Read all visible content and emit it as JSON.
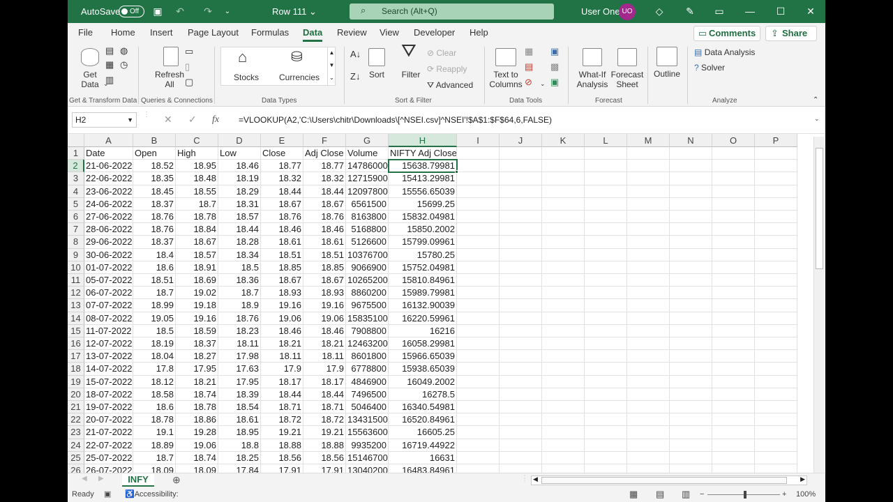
{
  "titlebar": {
    "autosave": "AutoSave",
    "toggle": "Off",
    "doc": "Row 111",
    "search": "Search (Alt+Q)",
    "user": "User One",
    "initials": "UO"
  },
  "menu": [
    "File",
    "Home",
    "Insert",
    "Page Layout",
    "Formulas",
    "Data",
    "Review",
    "View",
    "Developer",
    "Help"
  ],
  "top_buttons": {
    "comments": "Comments",
    "share": "Share"
  },
  "ribbon": {
    "get_data": "Get Data",
    "refresh_all": "Refresh All",
    "stocks": "Stocks",
    "currencies": "Currencies",
    "sort": "Sort",
    "filter": "Filter",
    "clear": "Clear",
    "reapply": "Reapply",
    "advanced": "Advanced",
    "text_to_columns": "Text to Columns",
    "what_if": "What-If Analysis",
    "forecast_sheet": "Forecast Sheet",
    "outline": "Outline",
    "data_analysis": "Data Analysis",
    "solver": "Solver",
    "groups": [
      "Get & Transform Data",
      "Queries & Connections",
      "Data Types",
      "Sort & Filter",
      "Data Tools",
      "Forecast",
      "Analyze"
    ]
  },
  "formula_bar": {
    "name_box": "H2",
    "fx": "fx",
    "formula": "=VLOOKUP(A2,'C:\\Users\\chitr\\Downloads\\[^NSEI.csv]^NSEI'!$A$1:$F$64,6,FALSE)"
  },
  "columns": [
    "A",
    "B",
    "C",
    "D",
    "E",
    "F",
    "G",
    "H",
    "I",
    "J",
    "K",
    "L",
    "M",
    "N",
    "O",
    "P"
  ],
  "header_row": [
    "Date",
    "Open",
    "High",
    "Low",
    "Close",
    "Adj Close",
    "Volume",
    "NIFTY Adj Close"
  ],
  "rows": [
    [
      "21-06-2022",
      "18.52",
      "18.95",
      "18.46",
      "18.77",
      "18.77",
      "14786000",
      "15638.79981"
    ],
    [
      "22-06-2022",
      "18.35",
      "18.48",
      "18.19",
      "18.32",
      "18.32",
      "12715900",
      "15413.29981"
    ],
    [
      "23-06-2022",
      "18.45",
      "18.55",
      "18.29",
      "18.44",
      "18.44",
      "12097800",
      "15556.65039"
    ],
    [
      "24-06-2022",
      "18.37",
      "18.7",
      "18.31",
      "18.67",
      "18.67",
      "6561500",
      "15699.25"
    ],
    [
      "27-06-2022",
      "18.76",
      "18.78",
      "18.57",
      "18.76",
      "18.76",
      "8163800",
      "15832.04981"
    ],
    [
      "28-06-2022",
      "18.76",
      "18.84",
      "18.44",
      "18.46",
      "18.46",
      "5168800",
      "15850.2002"
    ],
    [
      "29-06-2022",
      "18.37",
      "18.67",
      "18.28",
      "18.61",
      "18.61",
      "5126600",
      "15799.09961"
    ],
    [
      "30-06-2022",
      "18.4",
      "18.57",
      "18.34",
      "18.51",
      "18.51",
      "10376700",
      "15780.25"
    ],
    [
      "01-07-2022",
      "18.6",
      "18.91",
      "18.5",
      "18.85",
      "18.85",
      "9066900",
      "15752.04981"
    ],
    [
      "05-07-2022",
      "18.51",
      "18.69",
      "18.36",
      "18.67",
      "18.67",
      "10265200",
      "15810.84961"
    ],
    [
      "06-07-2022",
      "18.7",
      "19.02",
      "18.7",
      "18.93",
      "18.93",
      "8860200",
      "15989.79981"
    ],
    [
      "07-07-2022",
      "18.99",
      "19.18",
      "18.9",
      "19.16",
      "19.16",
      "9675500",
      "16132.90039"
    ],
    [
      "08-07-2022",
      "19.05",
      "19.16",
      "18.76",
      "19.06",
      "19.06",
      "15835100",
      "16220.59961"
    ],
    [
      "11-07-2022",
      "18.5",
      "18.59",
      "18.23",
      "18.46",
      "18.46",
      "7908800",
      "16216"
    ],
    [
      "12-07-2022",
      "18.19",
      "18.37",
      "18.11",
      "18.21",
      "18.21",
      "12463200",
      "16058.29981"
    ],
    [
      "13-07-2022",
      "18.04",
      "18.27",
      "17.98",
      "18.11",
      "18.11",
      "8601800",
      "15966.65039"
    ],
    [
      "14-07-2022",
      "17.8",
      "17.95",
      "17.63",
      "17.9",
      "17.9",
      "6778800",
      "15938.65039"
    ],
    [
      "15-07-2022",
      "18.12",
      "18.21",
      "17.95",
      "18.17",
      "18.17",
      "4846900",
      "16049.2002"
    ],
    [
      "18-07-2022",
      "18.58",
      "18.74",
      "18.39",
      "18.44",
      "18.44",
      "7496500",
      "16278.5"
    ],
    [
      "19-07-2022",
      "18.6",
      "18.78",
      "18.54",
      "18.71",
      "18.71",
      "5046400",
      "16340.54981"
    ],
    [
      "20-07-2022",
      "18.78",
      "18.86",
      "18.61",
      "18.72",
      "18.72",
      "13431500",
      "16520.84961"
    ],
    [
      "21-07-2022",
      "19.1",
      "19.28",
      "18.95",
      "19.21",
      "19.21",
      "15563600",
      "16605.25"
    ],
    [
      "22-07-2022",
      "18.89",
      "19.06",
      "18.8",
      "18.88",
      "18.88",
      "9935200",
      "16719.44922"
    ],
    [
      "25-07-2022",
      "18.7",
      "18.74",
      "18.25",
      "18.56",
      "18.56",
      "15146700",
      "16631"
    ],
    [
      "26-07-2022",
      "18.09",
      "18.09",
      "17.84",
      "17.91",
      "17.91",
      "13040200",
      "16483.84961"
    ]
  ],
  "sheet_tab": "INFY",
  "status": {
    "ready": "Ready",
    "accessibility": "Accessibility: Good to go",
    "zoom": "100%"
  }
}
